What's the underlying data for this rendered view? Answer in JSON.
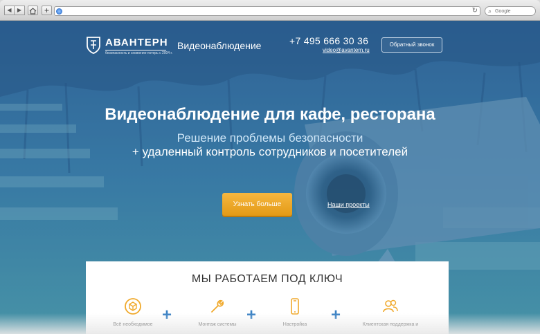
{
  "browser": {
    "search_placeholder": "Google",
    "icons": [
      "back-icon",
      "forward-icon",
      "home-icon",
      "add-bookmark-icon",
      "globe-icon",
      "reload-icon",
      "search-icon"
    ]
  },
  "header": {
    "logo_name": "АВАНТЕРН",
    "logo_tagline": "безопасность и снижение потерь с 2004 г.",
    "service": "Видеонаблюдение",
    "phone": "+7 495 666 30 36",
    "email": "video@avantern.ru",
    "callback_label": "Обратный звонок"
  },
  "hero": {
    "title": "Видеонаблюдение для кафе, ресторана",
    "subtitle_1": "Решение проблемы безопасности",
    "subtitle_2": "+ удаленный контроль сотрудников и посетителей",
    "primary_button": "Узнать больше",
    "secondary_link": "Наши проекты"
  },
  "features": {
    "title": "МЫ РАБОТАЕМ ПОД КЛЮЧ",
    "items": [
      {
        "label": "Всё необходимое",
        "icon": "package-icon"
      },
      {
        "label": "Монтаж системы",
        "icon": "wrench-icon"
      },
      {
        "label": "Настройка",
        "icon": "smartphone-icon"
      },
      {
        "label": "Клиентская поддержка и",
        "icon": "users-icon"
      }
    ],
    "separator": "+"
  },
  "colors": {
    "accent_orange": "#f0a92b",
    "brand_blue": "#3b82c4",
    "feature_icon": "#f0a92b"
  }
}
